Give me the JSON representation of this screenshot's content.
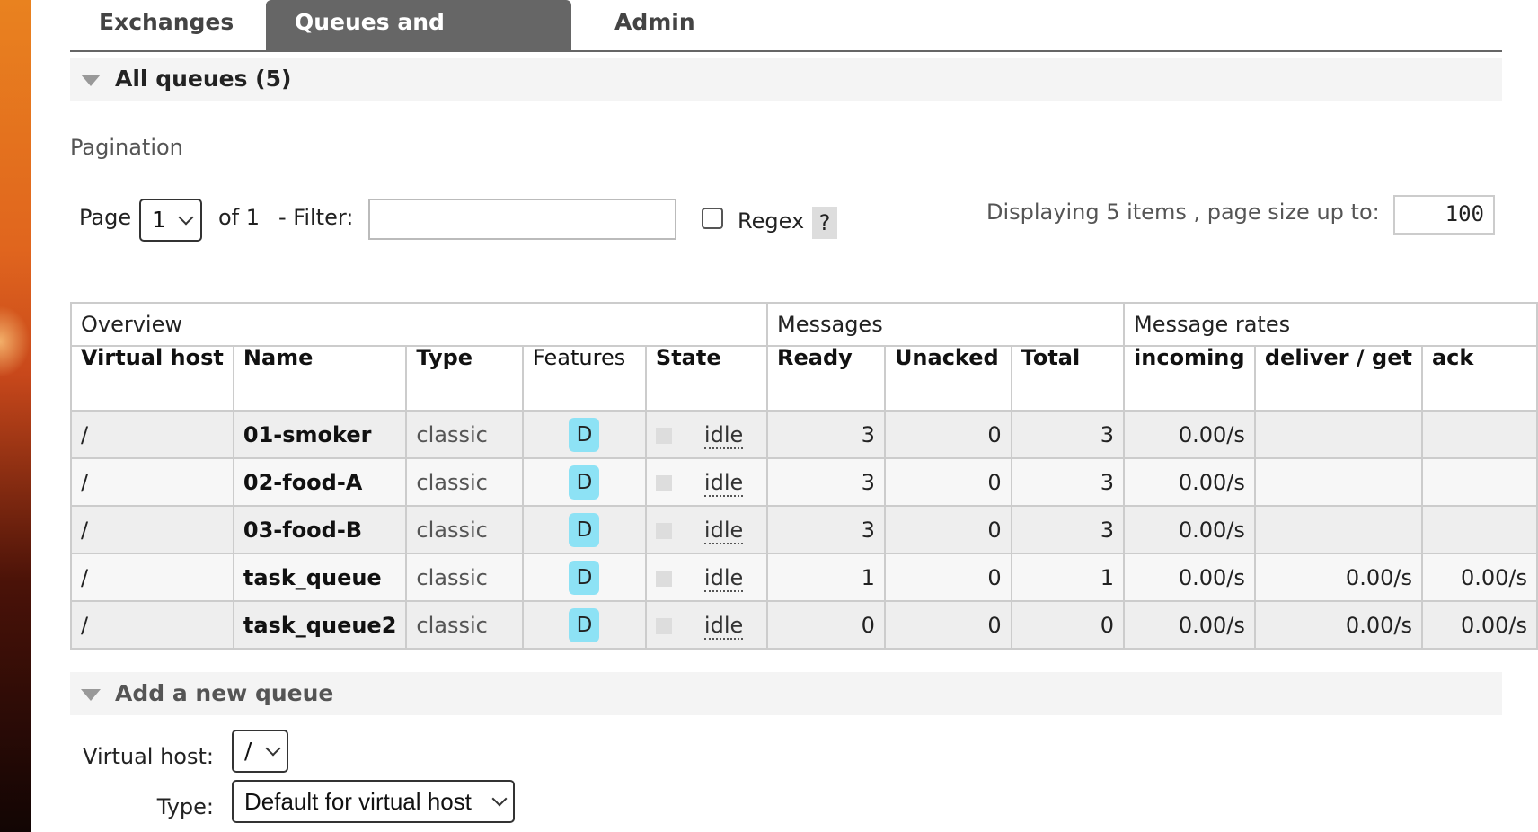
{
  "tabs": [
    {
      "label": "Exchanges",
      "active": false
    },
    {
      "label": "Queues and Streams",
      "active": true
    },
    {
      "label": "Admin",
      "active": false
    }
  ],
  "all_queues": {
    "title": "All queues (5)"
  },
  "pagination": {
    "title": "Pagination",
    "page_label": "Page",
    "page_value": "1",
    "of_label": "of 1",
    "filter_label": "- Filter:",
    "filter_value": "",
    "regex_label": "Regex",
    "regex_checked": false,
    "help_label": "?",
    "displaying_label": "Displaying 5 items , page size up to:",
    "page_size": "100"
  },
  "table": {
    "groups": [
      "Overview",
      "Messages",
      "Message rates"
    ],
    "headers": [
      "Virtual host",
      "Name",
      "Type",
      "Features",
      "State",
      "Ready",
      "Unacked",
      "Total",
      "incoming",
      "deliver / get",
      "ack"
    ],
    "rows": [
      {
        "vhost": "/",
        "name": "01-smoker",
        "type": "classic",
        "feature": "D",
        "state": "idle",
        "ready": "3",
        "unacked": "0",
        "total": "3",
        "incoming": "0.00/s",
        "deliver": "",
        "ack": ""
      },
      {
        "vhost": "/",
        "name": "02-food-A",
        "type": "classic",
        "feature": "D",
        "state": "idle",
        "ready": "3",
        "unacked": "0",
        "total": "3",
        "incoming": "0.00/s",
        "deliver": "",
        "ack": ""
      },
      {
        "vhost": "/",
        "name": "03-food-B",
        "type": "classic",
        "feature": "D",
        "state": "idle",
        "ready": "3",
        "unacked": "0",
        "total": "3",
        "incoming": "0.00/s",
        "deliver": "",
        "ack": ""
      },
      {
        "vhost": "/",
        "name": "task_queue",
        "type": "classic",
        "feature": "D",
        "state": "idle",
        "ready": "1",
        "unacked": "0",
        "total": "1",
        "incoming": "0.00/s",
        "deliver": "0.00/s",
        "ack": "0.00/s"
      },
      {
        "vhost": "/",
        "name": "task_queue2",
        "type": "classic",
        "feature": "D",
        "state": "idle",
        "ready": "0",
        "unacked": "0",
        "total": "0",
        "incoming": "0.00/s",
        "deliver": "0.00/s",
        "ack": "0.00/s"
      }
    ]
  },
  "add_queue": {
    "title": "Add a new queue",
    "vhost_label": "Virtual host:",
    "vhost_value": "/",
    "type_label": "Type:",
    "type_value": "Default for virtual host"
  },
  "colors": {
    "tab_active": "#666666",
    "badge": "#8de2f5",
    "row_odd": "#eeeeee",
    "row_even": "#f7f7f7"
  }
}
